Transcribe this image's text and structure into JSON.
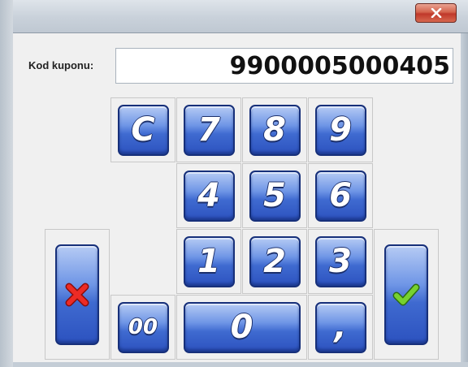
{
  "window": {
    "close_icon": "close-x-icon",
    "close_color": "#c7402d"
  },
  "coupon": {
    "label": "Kod kuponu:",
    "value": "9900005000405"
  },
  "keypad": {
    "clear": "C",
    "digits": {
      "seven": "7",
      "eight": "8",
      "nine": "9",
      "four": "4",
      "five": "5",
      "six": "6",
      "one": "1",
      "two": "2",
      "three": "3",
      "zero": "0"
    },
    "double_zero": "00",
    "decimal": ",",
    "cancel_icon": "cancel-x-icon",
    "confirm_icon": "check-icon",
    "key_color": "#3f6ad0"
  }
}
